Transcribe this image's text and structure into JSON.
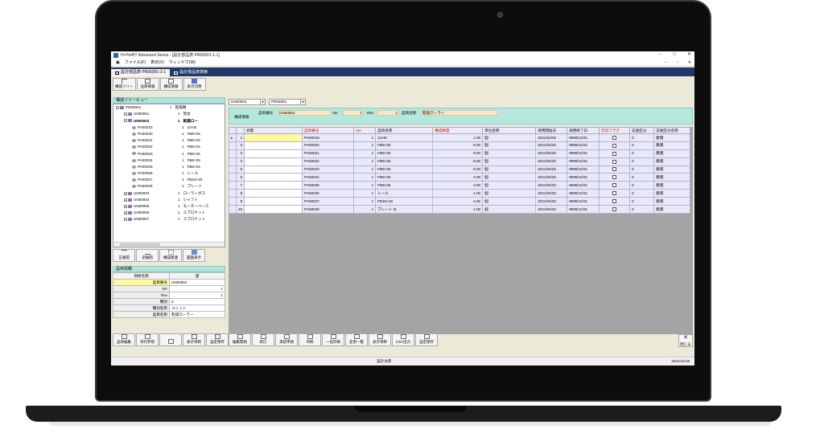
{
  "window": {
    "title": "Hi-PerBT Advanced Series - [設計部品表 PR00001-1-1]"
  },
  "menu": [
    "ファイル(F)",
    "表示(V)",
    "ウィンドウ(W)"
  ],
  "doc_tabs": [
    "設計部品表 PR00001-1-1",
    "設計部品表検索"
  ],
  "left_toolbar": [
    "構成ツリー",
    "品目情報",
    "構成情報",
    "表示切替"
  ],
  "tree_panel": {
    "title": "構成ツリービュー"
  },
  "tree": [
    {
      "code": "PR00001",
      "qty": "1",
      "name": "乾燥機",
      "level": 0
    },
    {
      "code": "UN00001",
      "qty": "1",
      "name": "架台",
      "level": 1
    },
    {
      "code": "UN00002",
      "qty": "1",
      "name": "乾燥ロー",
      "level": 1
    },
    {
      "code": "PA00019",
      "qty": "1",
      "name": "14×5t",
      "level": 2
    },
    {
      "code": "PA00020",
      "qty": "1",
      "name": "FB8×25",
      "level": 2
    },
    {
      "code": "PA00021",
      "qty": "1",
      "name": "FB8×25",
      "level": 2
    },
    {
      "code": "PA00022",
      "qty": "1",
      "name": "FB8×25",
      "level": 2
    },
    {
      "code": "PA00023",
      "qty": "1",
      "name": "FB8×25",
      "level": 2
    },
    {
      "code": "PA00024",
      "qty": "1",
      "name": "FB8×25",
      "level": 2
    },
    {
      "code": "PA00025",
      "qty": "1",
      "name": "FB8×25",
      "level": 2
    },
    {
      "code": "PA00026",
      "qty": "1",
      "name": "レール",
      "level": 2
    },
    {
      "code": "PA00027",
      "qty": "1",
      "name": "FB16×19",
      "level": 2
    },
    {
      "code": "PA00028",
      "qty": "1",
      "name": "プレート",
      "level": 2
    },
    {
      "code": "UN00003",
      "qty": "1",
      "name": "ローラーボス",
      "level": 1
    },
    {
      "code": "UN00004",
      "qty": "1",
      "name": "シャフト",
      "level": 1
    },
    {
      "code": "UN00005",
      "qty": "1",
      "name": "モーターベース",
      "level": 1
    },
    {
      "code": "UN00006",
      "qty": "1",
      "name": "スプロケット",
      "level": 1
    },
    {
      "code": "UN00007",
      "qty": "1",
      "name": "スプロケット",
      "level": 1
    }
  ],
  "tree_toolbar": [
    "正展開",
    "逆展開",
    "構成関連",
    "図面表示"
  ],
  "props_panel": {
    "title": "品目情報",
    "col_name": "項目名称",
    "col_value": "値"
  },
  "props": [
    {
      "k": "品目番号",
      "v": "UN00002"
    },
    {
      "k": "Ver",
      "v": "1"
    },
    {
      "k": "Rev",
      "v": "1"
    },
    {
      "k": "種別",
      "v": "2"
    },
    {
      "k": "種別名称",
      "v": "ユニット"
    },
    {
      "k": "品目名称",
      "v": "乾燥ローラー"
    }
  ],
  "props_toolbar": [
    "品目編集",
    "添付参照",
    "",
    "表示項目",
    "設定保存"
  ],
  "main": {
    "combo1": "UN00002",
    "combo2": "PR00001",
    "info_title": "構成情報",
    "part_label": "品目番号",
    "part_value": "UN00002",
    "ver_label": "Ver",
    "ver_value": "1",
    "rev_label": "Rev",
    "rev_value": "1",
    "name_label": "品目名称",
    "name_value": "乾燥ローラー"
  },
  "grid": {
    "headers": [
      "",
      "状態",
      "品目番号",
      "Ver",
      "品目名称",
      "構成数量",
      "単位名称",
      "適用開始日",
      "適用終了日",
      "打切フラグ",
      "支給区分",
      "支給区分名称"
    ],
    "red_headers": [
      2,
      3,
      5,
      9
    ],
    "rows": [
      [
        "1",
        "",
        "PA00019",
        "1",
        "14×5t",
        "1.00",
        "個",
        "2021/04/02",
        "9999/12/31",
        "",
        "0",
        "無償"
      ],
      [
        "2",
        "",
        "PA00020",
        "1",
        "FB8×25",
        "8.00",
        "個",
        "2021/04/02",
        "9999/12/31",
        "",
        "0",
        "無償"
      ],
      [
        "3",
        "",
        "PA00021",
        "1",
        "FB8×25",
        "8.00",
        "個",
        "2021/04/02",
        "9999/12/31",
        "",
        "0",
        "無償"
      ],
      [
        "4",
        "",
        "PA00022",
        "1",
        "FB8×25",
        "8.00",
        "個",
        "2021/04/02",
        "9999/12/31",
        "",
        "0",
        "無償"
      ],
      [
        "5",
        "",
        "PA00023",
        "1",
        "FB8×25",
        "8.00",
        "個",
        "2021/04/02",
        "9999/12/31",
        "",
        "0",
        "無償"
      ],
      [
        "6",
        "",
        "PA00024",
        "1",
        "FB8×25",
        "4.00",
        "個",
        "2021/04/02",
        "9999/12/31",
        "",
        "0",
        "無償"
      ],
      [
        "7",
        "",
        "PA00025",
        "1",
        "FB8×25",
        "3.00",
        "個",
        "2021/04/02",
        "9999/12/31",
        "",
        "0",
        "無償"
      ],
      [
        "8",
        "",
        "PA00026",
        "1",
        "レール",
        "1.00",
        "個",
        "2021/04/02",
        "9999/12/31",
        "",
        "0",
        "無償"
      ],
      [
        "9",
        "",
        "PA00027",
        "1",
        "FB16×19",
        "4.00",
        "個",
        "2021/04/02",
        "9999/12/31",
        "",
        "0",
        "無償"
      ],
      [
        "10",
        "",
        "PA00028",
        "1",
        "プレート t2",
        "1.00",
        "個",
        "2021/04/02",
        "9999/12/31",
        "",
        "0",
        "無償"
      ]
    ]
  },
  "bottom_toolbar": [
    "編集開始",
    "改訂",
    "承認申請",
    "印刷",
    "一括印刷",
    "変更一覧",
    "表示項目",
    "CSV出力",
    "設定保存"
  ],
  "close_label": "閉じる",
  "status": {
    "user": "設計太郎",
    "date": "2024/11/18"
  },
  "colors": {
    "accent": "#1f3a68",
    "panel": "#b5e8dc",
    "selected": "#fffa9c",
    "required": "#d01010"
  }
}
